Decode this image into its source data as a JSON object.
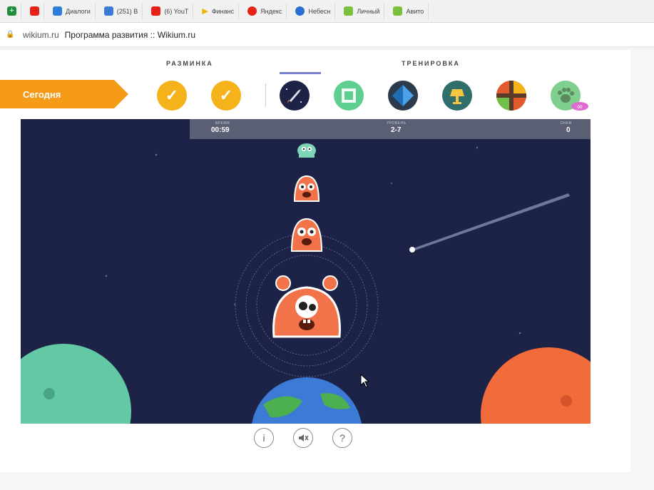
{
  "bookmarks": [
    {
      "label": "",
      "icon": "green-plus-icon",
      "color": "#1e8e3e"
    },
    {
      "label": "",
      "icon": "youtube-icon",
      "color": "#e62117"
    },
    {
      "label": "Диалоги",
      "icon": "chat-icon",
      "color": "#2b7fd8"
    },
    {
      "label": "(251) В",
      "icon": "mail-icon",
      "color": "#3a7bd5"
    },
    {
      "label": "(6) YouT",
      "icon": "youtube-icon",
      "color": "#e62117"
    },
    {
      "label": "Финанс",
      "icon": "play-icon",
      "color": "#f0b400"
    },
    {
      "label": "Яндекс",
      "icon": "yandex-icon",
      "color": "#e62117"
    },
    {
      "label": "Небесн",
      "icon": "sphere-icon",
      "color": "#2a6fcf"
    },
    {
      "label": "Личный",
      "icon": "avito-icon",
      "color": "#7cbf3f"
    },
    {
      "label": "Авито",
      "icon": "avito-icon",
      "color": "#7cbf3f"
    }
  ],
  "address": {
    "domain": "wikium.ru",
    "title": "Программа развития :: Wikium.ru"
  },
  "sections": {
    "warmup": "РАЗМИНКА",
    "training": "ТРЕНИРОВКА"
  },
  "today_label": "Сегодня",
  "colors": {
    "accent_orange": "#f59b17",
    "check_yellow": "#f5b21a",
    "space": "#1d2247",
    "hud": "#5b5f74",
    "tab_underline": "#7b7fcf"
  },
  "exercises": [
    {
      "name": "completed-1",
      "icon": "check-icon",
      "glyph": "✓"
    },
    {
      "name": "completed-2",
      "icon": "check-icon",
      "glyph": "✓"
    },
    {
      "name": "space-rocket",
      "icon": "rocket-icon"
    },
    {
      "name": "green-square",
      "icon": "square-icon"
    },
    {
      "name": "blue-diamond",
      "icon": "diamond-icon"
    },
    {
      "name": "lamp",
      "icon": "lamp-icon"
    },
    {
      "name": "cross",
      "icon": "cross-icon"
    },
    {
      "name": "paw",
      "icon": "paw-icon"
    }
  ],
  "hud": {
    "time_label": "ВРЕМЯ",
    "time_value": "00:59",
    "level_label": "УРОВЕНЬ",
    "level_value": "2-7",
    "score_label": "ОЧКИ",
    "score_value": "0"
  },
  "controls": [
    {
      "name": "info",
      "glyph": "i"
    },
    {
      "name": "sound-off",
      "glyph": "🔇"
    },
    {
      "name": "help",
      "glyph": "?"
    }
  ]
}
